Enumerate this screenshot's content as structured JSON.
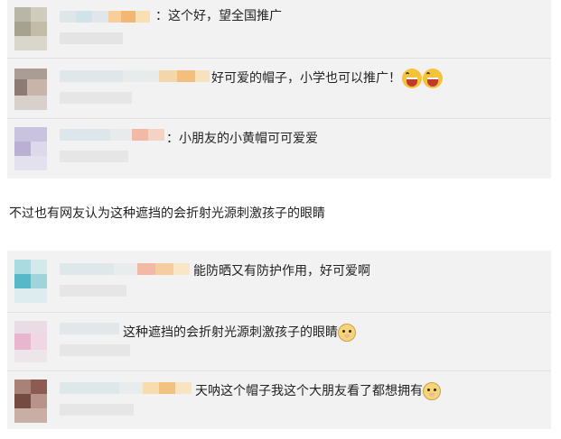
{
  "colors": {
    "panel_bg": "#f2f2f2",
    "divider": "#e2e2e2",
    "text": "#222222"
  },
  "comments_top": [
    {
      "text": "：这个好，望全国推广",
      "emoji": []
    },
    {
      "text": "好可爱的帽子，小学也可以推广！",
      "emoji": [
        "laughing-face-icon",
        "laughing-face-icon"
      ]
    },
    {
      "text": "：小朋友的小黄帽可可爱爱",
      "emoji": []
    }
  ],
  "middle_text": "不过也有网友认为这种遮挡的会折射光源刺激孩子的眼睛",
  "comments_bottom": [
    {
      "text": "能防晒又有防护作用，好可爱啊",
      "emoji": []
    },
    {
      "text": "这种遮挡的会折射光源刺激孩子的眼睛",
      "emoji": [
        "doge-face-icon"
      ]
    },
    {
      "text": "天呐这个帽子我这个大朋友看了都想拥有",
      "emoji": [
        "doge-face-icon"
      ]
    }
  ]
}
